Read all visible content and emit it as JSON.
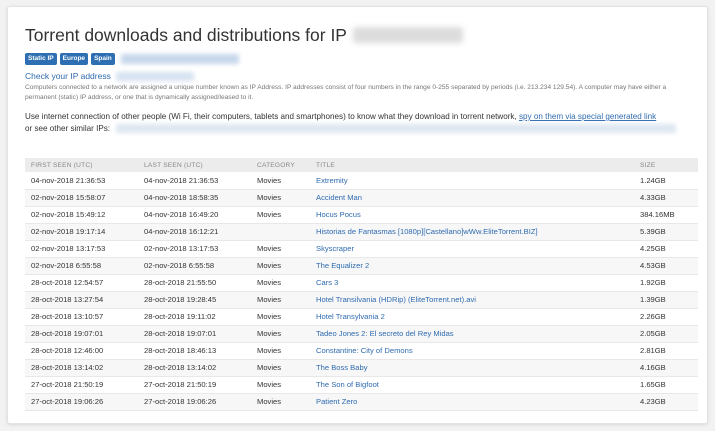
{
  "page": {
    "title": "Torrent downloads and distributions for IP",
    "badges": [
      "Static IP",
      "Europe",
      "Spain"
    ],
    "check_link": "Check your IP address",
    "description": "Computers connected to a network are assigned a unique number known as IP Address. IP addresses consist of four numbers in the range 0-255 separated by periods (i.e. 213.234 129.54). A computer may have either a permanent (static) IP address, or one that is dynamically assigned/leased to it.",
    "intro_text": "Use internet connection of other people (Wi Fi, their computers, tablets and smartphones) to know what they download in torrent network,",
    "intro_link": "spy on them via special generated link",
    "intro_tail": "or see other similar IPs:"
  },
  "table": {
    "headers": [
      "First seen (UTC)",
      "Last seen (UTC)",
      "Category",
      "Title",
      "Size"
    ],
    "rows": [
      {
        "first": "04-nov-2018 21:36:53",
        "last": "04-nov-2018 21:36:53",
        "category": "Movies",
        "title": "Extremity",
        "size": "1.24GB"
      },
      {
        "first": "02-nov-2018 15:58:07",
        "last": "04-nov-2018 18:58:35",
        "category": "Movies",
        "title": "Accident Man",
        "size": "4.33GB"
      },
      {
        "first": "02-nov-2018 15:49:12",
        "last": "04-nov-2018 16:49:20",
        "category": "Movies",
        "title": "Hocus Pocus",
        "size": "384.16MB"
      },
      {
        "first": "02-nov-2018 19:17:14",
        "last": "04-nov-2018 16:12:21",
        "category": "",
        "title": "Historias de Fantasmas [1080p][Castellano]wWw.EliteTorrent.BIZ]",
        "size": "5.39GB"
      },
      {
        "first": "02-nov-2018 13:17:53",
        "last": "02-nov-2018 13:17:53",
        "category": "Movies",
        "title": "Skyscraper",
        "size": "4.25GB"
      },
      {
        "first": "02-nov-2018 6:55:58",
        "last": "02-nov-2018 6:55:58",
        "category": "Movies",
        "title": "The Equalizer 2",
        "size": "4.53GB"
      },
      {
        "first": "28-oct-2018 12:54:57",
        "last": "28-oct-2018 21:55:50",
        "category": "Movies",
        "title": "Cars 3",
        "size": "1.92GB"
      },
      {
        "first": "28-oct-2018 13:27:54",
        "last": "28-oct-2018 19:28:45",
        "category": "Movies",
        "title": "Hotel Transilvania (HDRip) (EliteTorrent.net).avi",
        "size": "1.39GB"
      },
      {
        "first": "28-oct-2018 13:10:57",
        "last": "28-oct-2018 19:11:02",
        "category": "Movies",
        "title": "Hotel Transylvania 2",
        "size": "2.26GB"
      },
      {
        "first": "28-oct-2018 19:07:01",
        "last": "28-oct-2018 19:07:01",
        "category": "Movies",
        "title": "Tadeo Jones 2: El secreto del Rey Midas",
        "size": "2.05GB"
      },
      {
        "first": "28-oct-2018 12:46:00",
        "last": "28-oct-2018 18:46:13",
        "category": "Movies",
        "title": "Constantine: City of Demons",
        "size": "2.81GB"
      },
      {
        "first": "28-oct-2018 13:14:02",
        "last": "28-oct-2018 13:14:02",
        "category": "Movies",
        "title": "The Boss Baby",
        "size": "4.16GB"
      },
      {
        "first": "27-oct-2018 21:50:19",
        "last": "27-oct-2018 21:50:19",
        "category": "Movies",
        "title": "The Son of Bigfoot",
        "size": "1.65GB"
      },
      {
        "first": "27-oct-2018 19:06:26",
        "last": "27-oct-2018 19:06:26",
        "category": "Movies",
        "title": "Patient Zero",
        "size": "4.23GB"
      }
    ]
  },
  "colors": {
    "accent": "#2d6fb2",
    "link": "#2f6bb0",
    "header_bg": "#ececec"
  }
}
